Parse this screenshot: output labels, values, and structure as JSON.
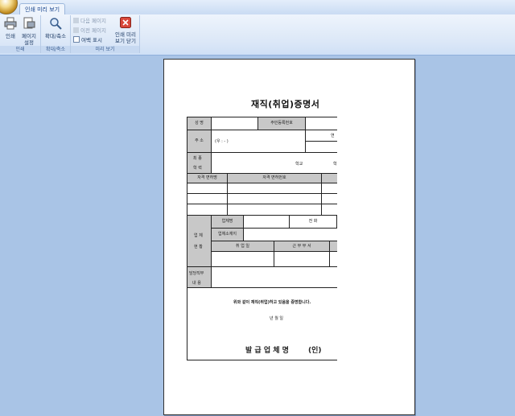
{
  "ribbon": {
    "tab_label": "인쇄 미리 보기",
    "groups": {
      "print": {
        "label": "인쇄",
        "print_btn": "인쇄",
        "page_setup_line1": "페이지",
        "page_setup_line2": "설정"
      },
      "zoom": {
        "label": "확대/축소",
        "zoom_btn": "확대/축소"
      },
      "preview": {
        "label": "미리 보기",
        "next_page": "다음 페이지",
        "prev_page": "이전 페이지",
        "show_margins": "여백 표시",
        "close_line1": "인쇄 미리",
        "close_line2": "보기 닫기"
      }
    }
  },
  "document": {
    "title": "재직(취업)증명서",
    "labels": {
      "name": "성 명",
      "resident_no": "주민등록번호",
      "address": "주 소",
      "address_value": "(우 :   -    )",
      "truncated_right": "연",
      "edu_1": "최 종",
      "edu_2": "학 력",
      "school": "학교",
      "school_trunc": "학",
      "license_name": "자격 면허명",
      "license_no": "자격 면허번호",
      "company_1": "업 체",
      "company_2": "현 황",
      "company_name": "업체명",
      "phone": "전 화",
      "company_addr": "업체소재지",
      "employed_date": "취 업 일",
      "department": "근 무 부 서",
      "duty_1": "담당직무",
      "duty_2": "내 용",
      "certify": "위와 같이 재직(취업)하고 있음을 증명합니다.",
      "date": "년   월   일",
      "issuer": "발 급 업 체 명",
      "seal": "(인)"
    }
  }
}
